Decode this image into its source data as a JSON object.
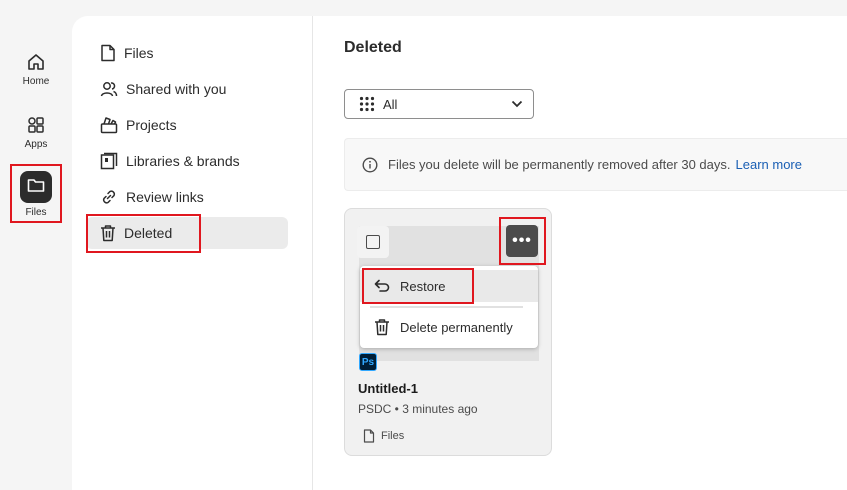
{
  "rail": {
    "items": [
      {
        "label": "Home",
        "icon": "home-icon"
      },
      {
        "label": "Apps",
        "icon": "apps-icon"
      },
      {
        "label": "Files",
        "icon": "folder-icon",
        "active": true
      }
    ]
  },
  "nav": {
    "items": [
      {
        "label": "Files",
        "icon": "file-icon"
      },
      {
        "label": "Shared with you",
        "icon": "people-icon"
      },
      {
        "label": "Projects",
        "icon": "projects-icon"
      },
      {
        "label": "Libraries & brands",
        "icon": "library-icon"
      },
      {
        "label": "Review links",
        "icon": "link-icon"
      },
      {
        "label": "Deleted",
        "icon": "trash-icon",
        "active": true
      }
    ]
  },
  "main": {
    "title": "Deleted",
    "filter": {
      "value": "All"
    },
    "notice": {
      "text": "Files you delete will be permanently removed after 30 days.",
      "link": "Learn more"
    }
  },
  "card": {
    "name": "Untitled-1",
    "meta": "PSDC • 3 minutes ago",
    "location": "Files",
    "badge": "Ps",
    "more_label": "•••",
    "menu": {
      "restore": "Restore",
      "delete": "Delete permanently"
    }
  },
  "colors": {
    "highlight": "#e0171f",
    "link": "#1a5fb4",
    "ps_badge_bg": "#001e36",
    "ps_badge_fg": "#31a8ff"
  }
}
